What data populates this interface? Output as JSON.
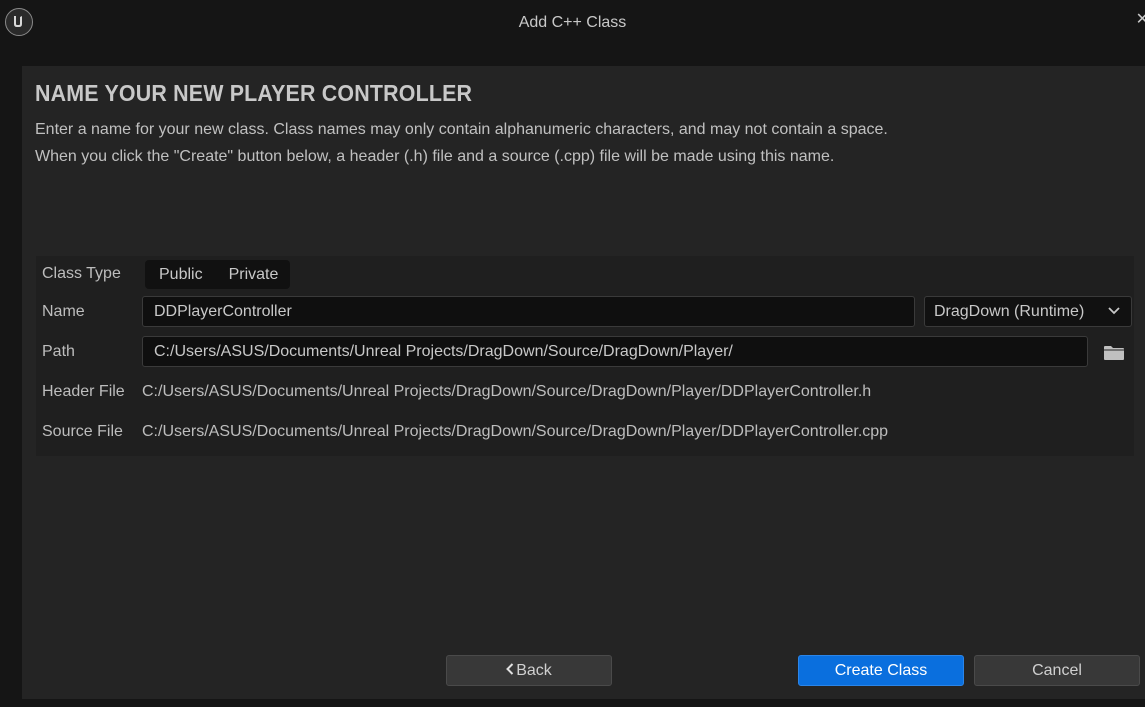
{
  "window": {
    "title": "Add C++ Class",
    "close_glyph": "✕",
    "logo_icon": "unreal-engine-logo"
  },
  "page": {
    "heading": "NAME YOUR NEW PLAYER CONTROLLER",
    "description_line1": "Enter a name for your new class. Class names may only contain alphanumeric characters, and may not contain a space.",
    "description_line2": "When you click the \"Create\" button below, a header (.h) file and a source (.cpp) file will be made using this name."
  },
  "form": {
    "class_type_label": "Class Type",
    "class_type_options": [
      "Public",
      "Private"
    ],
    "name_label": "Name",
    "name_value": "DDPlayerController",
    "module_dropdown": "DragDown (Runtime)",
    "path_label": "Path",
    "path_value": "C:/Users/ASUS/Documents/Unreal Projects/DragDown/Source/DragDown/Player/",
    "header_file_label": "Header File",
    "header_file_value": "C:/Users/ASUS/Documents/Unreal Projects/DragDown/Source/DragDown/Player/DDPlayerController.h",
    "source_file_label": "Source File",
    "source_file_value": "C:/Users/ASUS/Documents/Unreal Projects/DragDown/Source/DragDown/Player/DDPlayerController.cpp"
  },
  "buttons": {
    "back": "Back",
    "create": "Create Class",
    "cancel": "Cancel"
  },
  "colors": {
    "window_bg": "#151515",
    "panel_bg": "#242424",
    "primary_button": "#0a6fde"
  }
}
